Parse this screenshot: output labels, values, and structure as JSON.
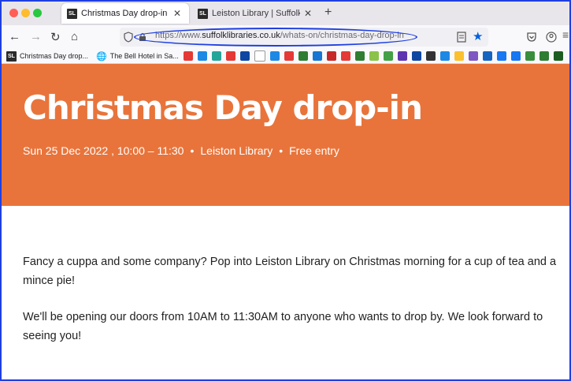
{
  "browser": {
    "tabs": [
      {
        "label": "Christmas Day drop-in | Suffolk",
        "icon": "SL"
      },
      {
        "label": "Leiston Library | Suffolk Libraries",
        "icon": "SL"
      }
    ],
    "new_tab": "+",
    "close": "✕",
    "url_scheme": "https://www.",
    "url_domain": "suffolklibraries.co.uk",
    "url_path": "/whats-on/christmas-day-drop-in"
  },
  "bookmarks": [
    {
      "label": "Christmas Day drop...",
      "icon": "SL"
    },
    {
      "label": "The Bell Hotel in Sa...",
      "icon": "globe"
    }
  ],
  "bookmark_icon_colors": [
    "#e53935",
    "#1e88e5",
    "#26a69a",
    "#e53935",
    "#0d47a1",
    "#ffffff",
    "#1e88e5",
    "#e53935",
    "#2e7d32",
    "#1976d2",
    "#c62828",
    "#e53935",
    "#2e7d32",
    "#8bc34a",
    "#43a047",
    "#5e35b1",
    "#0d47a1",
    "#333333",
    "#1e88e5",
    "#fbc02d",
    "#7e57c2",
    "#1565c0",
    "#1877f2",
    "#1877f2",
    "#388e3c",
    "#2e7d32",
    "#1b5e20"
  ],
  "event": {
    "title": "Christmas Day drop-in",
    "date": "Sun 25 Dec 2022 , 10:00 – 11:30",
    "location": "Leiston Library",
    "price": "Free entry",
    "separator": "•"
  },
  "content": {
    "para1": "Fancy a cuppa and some company? Pop into Leiston Library on Christmas morning for a cup of tea and a mince pie!",
    "para2": "We'll be opening our doors from 10AM to 11:30AM to anyone who wants to drop by. We look forward to seeing you!"
  },
  "colors": {
    "hero": "#e8743b",
    "annotation": "#1f3fe0"
  }
}
